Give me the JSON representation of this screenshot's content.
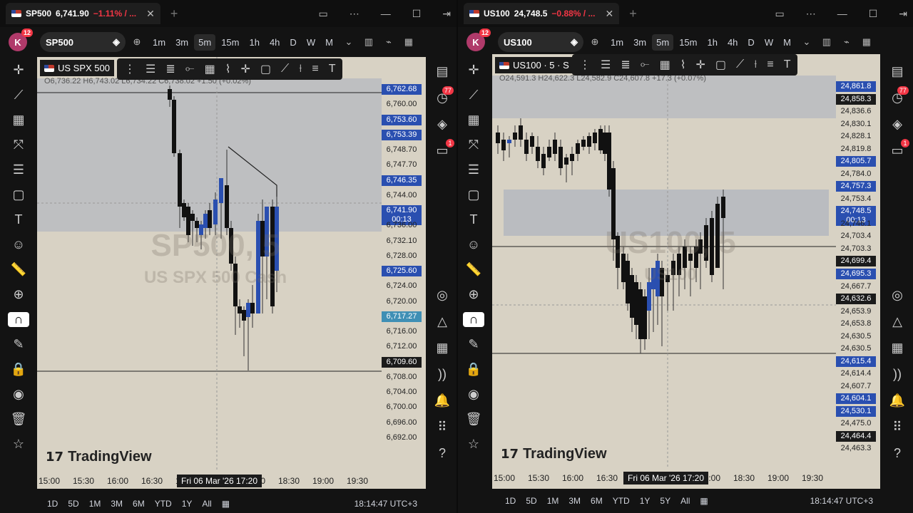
{
  "left": {
    "tab": {
      "symbol": "SP500",
      "price": "6,741.90",
      "change": "−1.11% / ..."
    },
    "symbol_box": "SP500",
    "timeframes": [
      "1m",
      "3m",
      "5m",
      "15m",
      "1h",
      "4h",
      "D",
      "W",
      "M"
    ],
    "active_tf": "5m",
    "chart_title": "US SPX 500",
    "ohlc": "O6,736.22 H6,743.02 L6,734.22 C6,738.02 +1.50 (+0.02%)",
    "watermark_sym": "SP500, 5",
    "watermark_name": "US SPX 500 Cash",
    "price_labels": [
      {
        "v": "6,762.68",
        "s": "blue"
      },
      {
        "v": "6,760.00",
        "s": ""
      },
      {
        "v": "6,753.60",
        "s": "blue"
      },
      {
        "v": "6,753.39",
        "s": "blue"
      },
      {
        "v": "6,748.70",
        "s": ""
      },
      {
        "v": "6,747.70",
        "s": ""
      },
      {
        "v": "6,746.35",
        "s": "blue"
      },
      {
        "v": "6,744.00",
        "s": ""
      },
      {
        "v": "6,741.90",
        "s": "blue",
        "cd": "00:13"
      },
      {
        "v": "6,736.00",
        "s": ""
      },
      {
        "v": "6,732.10",
        "s": ""
      },
      {
        "v": "6,728.00",
        "s": ""
      },
      {
        "v": "6,725.60",
        "s": "blue"
      },
      {
        "v": "6,724.00",
        "s": ""
      },
      {
        "v": "6,720.00",
        "s": ""
      },
      {
        "v": "6,717.27",
        "s": "teal"
      },
      {
        "v": "6,716.00",
        "s": ""
      },
      {
        "v": "6,712.00",
        "s": ""
      },
      {
        "v": "6,709.60",
        "s": "dark"
      },
      {
        "v": "6,708.00",
        "s": ""
      },
      {
        "v": "6,704.00",
        "s": ""
      },
      {
        "v": "6,700.00",
        "s": ""
      },
      {
        "v": "6,696.00",
        "s": ""
      },
      {
        "v": "6,692.00",
        "s": ""
      }
    ],
    "time_ticks": [
      "15:00",
      "15:30",
      "16:00",
      "16:30",
      "17:00",
      "17:30",
      "18:00",
      "18:30",
      "19:00",
      "19:30"
    ],
    "cursor_time": "Fri 06 Mar '26   17:20",
    "ranges": [
      "1D",
      "5D",
      "1M",
      "3M",
      "6M",
      "YTD",
      "1Y",
      "All"
    ],
    "clock": "18:14:47 UTC+3",
    "badge_alerts": "77",
    "badge_notif": "1",
    "avatar_count": "12"
  },
  "right": {
    "tab": {
      "symbol": "US100",
      "price": "24,748.5",
      "change": "−0.88% / ..."
    },
    "symbol_box": "US100",
    "timeframes": [
      "1m",
      "3m",
      "5m",
      "15m",
      "1h",
      "4h",
      "D",
      "W",
      "M"
    ],
    "active_tf": "5m",
    "chart_title": "US100 · 5 · S",
    "ohlc": "O24,591.3 H24,622.3 L24,582.9 C24,607.8 +17.3 (+0.07%)",
    "watermark_sym": "US100, 5",
    "watermark_name": "US100",
    "price_labels": [
      {
        "v": "24,861.8",
        "s": "blue"
      },
      {
        "v": "24,858.3",
        "s": "dark"
      },
      {
        "v": "24,836.6",
        "s": ""
      },
      {
        "v": "24,830.1",
        "s": ""
      },
      {
        "v": "24,828.1",
        "s": ""
      },
      {
        "v": "24,819.8",
        "s": ""
      },
      {
        "v": "24,805.7",
        "s": "blue"
      },
      {
        "v": "24,784.0",
        "s": ""
      },
      {
        "v": "24,757.3",
        "s": "blue"
      },
      {
        "v": "24,753.4",
        "s": ""
      },
      {
        "v": "24,748.5",
        "s": "blue",
        "cd": "00:13"
      },
      {
        "v": "24,746.1",
        "s": ""
      },
      {
        "v": "24,703.4",
        "s": ""
      },
      {
        "v": "24,703.3",
        "s": ""
      },
      {
        "v": "24,699.4",
        "s": "dark"
      },
      {
        "v": "24,695.3",
        "s": "blue"
      },
      {
        "v": "24,667.7",
        "s": ""
      },
      {
        "v": "24,632.6",
        "s": "dark"
      },
      {
        "v": "24,653.9",
        "s": ""
      },
      {
        "v": "24,653.8",
        "s": ""
      },
      {
        "v": "24,630.5",
        "s": ""
      },
      {
        "v": "24,630.5",
        "s": ""
      },
      {
        "v": "24,615.4",
        "s": "blue"
      },
      {
        "v": "24,614.4",
        "s": ""
      },
      {
        "v": "24,607.7",
        "s": ""
      },
      {
        "v": "24,604.1",
        "s": "blue"
      },
      {
        "v": "24,530.1",
        "s": "blue"
      },
      {
        "v": "24,475.0",
        "s": ""
      },
      {
        "v": "24,464.4",
        "s": "dark"
      },
      {
        "v": "24,463.3",
        "s": ""
      }
    ],
    "time_ticks": [
      "15:00",
      "15:30",
      "16:00",
      "16:30",
      "17:00",
      "17:30",
      "18:00",
      "18:30",
      "19:00",
      "19:30"
    ],
    "cursor_time": "Fri 06 Mar '26   17:20",
    "ranges": [
      "1D",
      "5D",
      "1M",
      "3M",
      "6M",
      "YTD",
      "1Y",
      "5Y",
      "All"
    ],
    "clock": "18:14:47 UTC+3",
    "badge_alerts": "77",
    "badge_notif": "1",
    "avatar_count": "12",
    "level_0": "0",
    "level_1": "1"
  },
  "brand": "TradingView",
  "colors": {
    "bull": "#2a4fb0",
    "bear": "#111111",
    "chart_bg": "#d8d2c4",
    "zone": "#aeb2bf"
  }
}
